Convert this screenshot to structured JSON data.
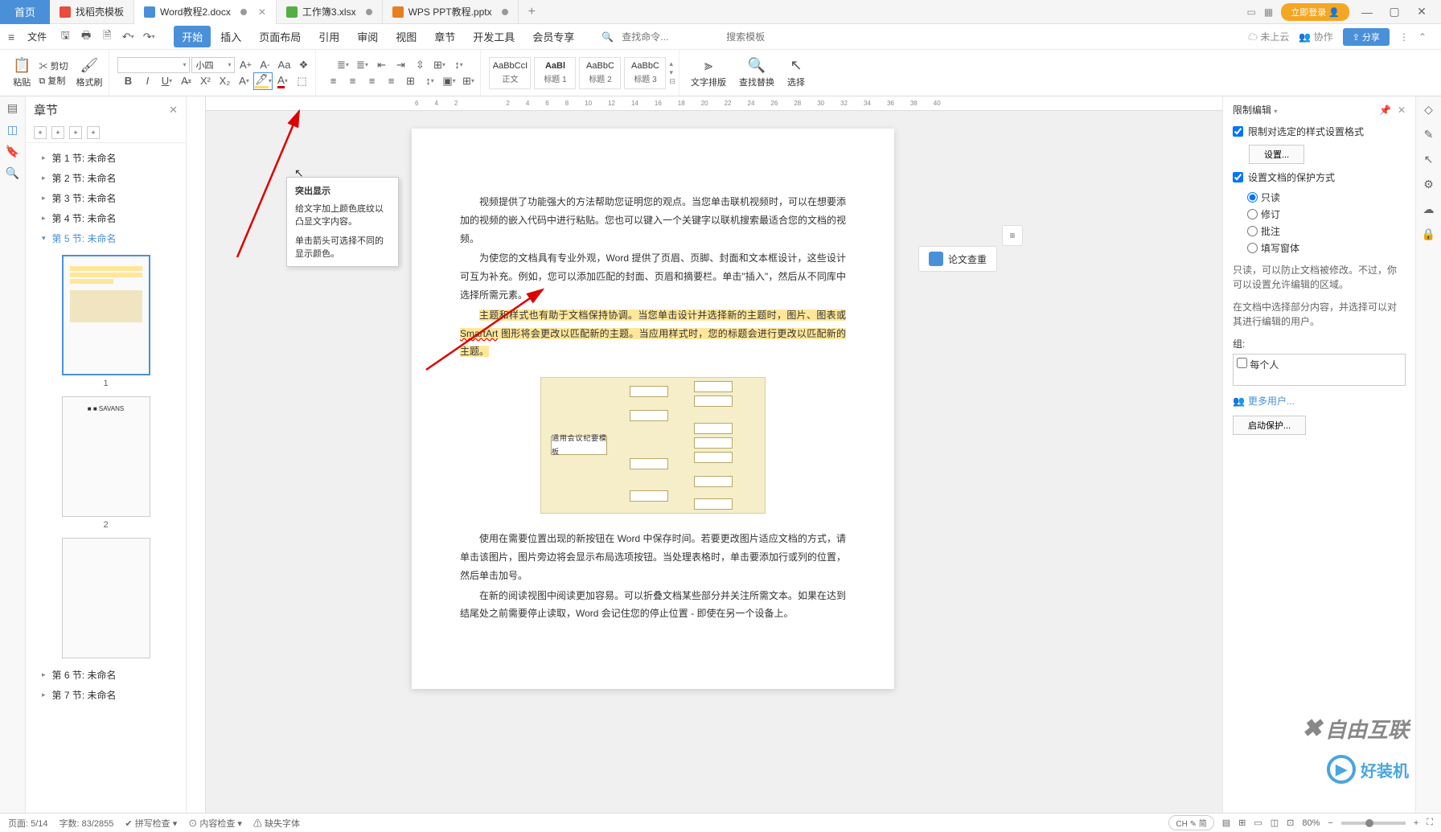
{
  "tabs": {
    "home": "首页",
    "t1": "找稻壳模板",
    "t2": "Word教程2.docx",
    "t3": "工作簿3.xlsx",
    "t4": "WPS PPT教程.pptx"
  },
  "titlebar": {
    "login": "立即登录"
  },
  "menubar": {
    "file": "文件",
    "tabs": [
      "开始",
      "插入",
      "页面布局",
      "引用",
      "审阅",
      "视图",
      "章节",
      "开发工具",
      "会员专享"
    ],
    "search_ph": "查找命令...",
    "search_tpl": "搜索模板",
    "cloud": "未上云",
    "coop": "协作",
    "share": "分享"
  },
  "ribbon": {
    "paste": "粘贴",
    "cut": "剪切",
    "copy": "复制",
    "format_painter": "格式刷",
    "font_size": "小四",
    "styles": {
      "s0": {
        "prev": "AaBbCcI",
        "lbl": "正文"
      },
      "s1": {
        "prev": "AaBl",
        "lbl": "标题 1"
      },
      "s2": {
        "prev": "AaBbC",
        "lbl": "标题 2"
      },
      "s3": {
        "prev": "AaBbC",
        "lbl": "标题 3"
      }
    },
    "text_layout": "文字排版",
    "find_replace": "查找替换",
    "select": "选择"
  },
  "tooltip": {
    "title": "突出显示",
    "body1": "给文字加上颜色底纹以凸显文字内容。",
    "body2": "单击箭头可选择不同的显示颜色。"
  },
  "nav": {
    "title": "章节",
    "items": [
      "第 1 节: 未命名",
      "第 2 节: 未命名",
      "第 3 节: 未命名",
      "第 4 节: 未命名",
      "第 5 节: 未命名",
      "第 6 节: 未命名",
      "第 7 节: 未命名"
    ],
    "thumb_nums": [
      "1",
      "2"
    ]
  },
  "ruler_h": [
    "6",
    "4",
    "2",
    "2",
    "4",
    "6",
    "8",
    "10",
    "12",
    "14",
    "16",
    "18",
    "20",
    "22",
    "24",
    "26",
    "28",
    "30",
    "32",
    "34",
    "36",
    "38",
    "40"
  ],
  "doc": {
    "p1": "视频提供了功能强大的方法帮助您证明您的观点。当您单击联机视频时，可以在想要添加的视频的嵌入代码中进行粘贴。您也可以键入一个关键字以联机搜索最适合您的文档的视频。",
    "p2": "为使您的文档具有专业外观，Word 提供了页眉、页脚、封面和文本框设计，这些设计可互为补充。例如，您可以添加匹配的封面、页眉和摘要栏。单击\"插入\"，然后从不同库中选择所需元素。",
    "p3a": "主题和样式也有助于文档保持协调。当您单击设计并选择新的主题时，图片、图表或 ",
    "p3b": "SmartArt",
    "p3c": " 图形将会更改以匹配新的主题。当应用样式时，您的标题会进行更改以匹配新的主题。",
    "diagram_center": "通用会议纪要模板",
    "p4": "使用在需要位置出现的新按钮在 Word 中保存时间。若要更改图片适应文档的方式，请单击该图片，图片旁边将会显示布局选项按钮。当处理表格时，单击要添加行或列的位置，然后单击加号。",
    "p5": "在新的阅读视图中阅读更加容易。可以折叠文档某些部分并关注所需文本。如果在达到结尾处之前需要停止读取，Word 会记住您的停止位置 - 即使在另一个设备上。"
  },
  "essay_check": "论文查重",
  "right_panel": {
    "title": "限制编辑",
    "chk1": "限制对选定的样式设置格式",
    "btn_set": "设置...",
    "chk2": "设置文档的保护方式",
    "radios": [
      "只读",
      "修订",
      "批注",
      "填写窗体"
    ],
    "desc1": "只读，可以防止文档被修改。不过，你可以设置允许编辑的区域。",
    "desc2": "在文档中选择部分内容，并选择可以对其进行编辑的用户。",
    "group_label": "组:",
    "everyone": "每个人",
    "more_users": "更多用户...",
    "start_protect": "启动保护..."
  },
  "statusbar": {
    "page": "页面: 5/14",
    "words": "字数: 83/2855",
    "spell": "拼写检查",
    "content": "内容检查",
    "missing": "缺失字体",
    "ime": "CH ✎ 简",
    "zoom": "80%"
  },
  "watermark1": "自由互联",
  "watermark2": "好装机"
}
